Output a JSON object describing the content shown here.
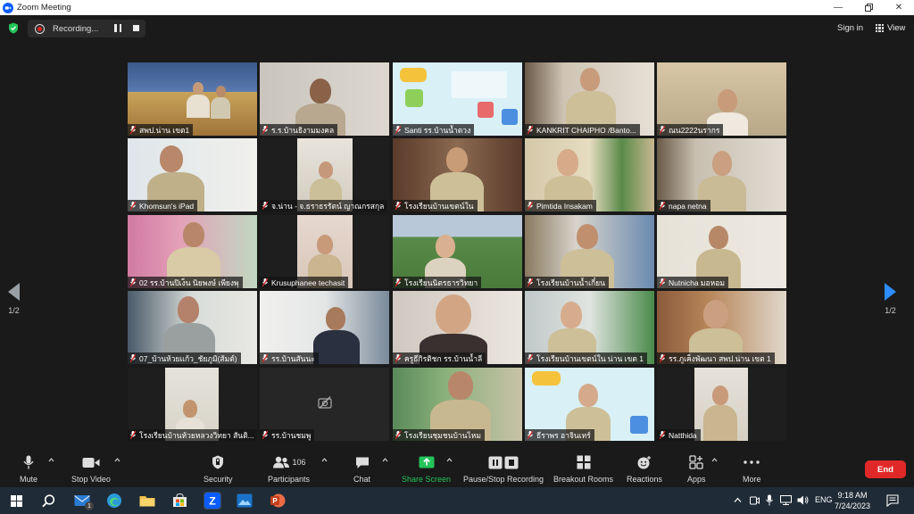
{
  "window": {
    "title": "Zoom Meeting"
  },
  "topbar": {
    "recording_label": "Recording...",
    "sign_in": "Sign in",
    "view": "View"
  },
  "gallery": {
    "page_indicator_left": "1/2",
    "page_indicator_right": "1/2",
    "tiles": [
      {
        "name": "สพป.น่าน เขต1"
      },
      {
        "name": "ร.ร.บ้านธิงามมงคล"
      },
      {
        "name": "Santi รร.บ้านน้ำตวง"
      },
      {
        "name": "KANKRIT CHAIPHO /Banto..."
      },
      {
        "name": "ณน2222นรากร"
      },
      {
        "name": "Khomsun's iPad"
      },
      {
        "name": "จ.น่าน - จ.ธราธรรัตน์ ญาณกรสกุล"
      },
      {
        "name": "โรงเรียนบ้านเขตน์ใน"
      },
      {
        "name": "Pimtida Insakam"
      },
      {
        "name": "napa netna"
      },
      {
        "name": "02 รร.บ้านปิเง็น นิยพงษ์ เพียงพุ"
      },
      {
        "name": "Krusuphanee techasit"
      },
      {
        "name": "โรงเรียนนิตรธารวิทยา"
      },
      {
        "name": "โรงเรียนบ้านน้ำเกี๋ยน"
      },
      {
        "name": "Nutnicha มอหอม"
      },
      {
        "name": "07_บ้านห้วยแก้ว_ชัยภูมิ(ส้มต์)"
      },
      {
        "name": "รร.บ้านสันนะ"
      },
      {
        "name": "ครูธีกิรติชก รร.บ้านน้ำลี"
      },
      {
        "name": "โรงเรียนบ้านเขตน์ใน น่าน เขต 1"
      },
      {
        "name": "รร.ภูเค็งพัฒนา สพป.น่าน เขต 1"
      },
      {
        "name": "โรงเรียนบ้านห้วยหลวงวิทยา สันติ..."
      },
      {
        "name": "รร.บ้านชมพู"
      },
      {
        "name": "โรงเรียนชุมชนบ้านไหม"
      },
      {
        "name": "ธีราพร อาจินเทร์"
      },
      {
        "name": "Natthida"
      }
    ]
  },
  "toolbar": {
    "mute": "Mute",
    "stop_video": "Stop Video",
    "security": "Security",
    "participants": "Participants",
    "participants_count": "106",
    "chat": "Chat",
    "share_screen": "Share Screen",
    "record": "Pause/Stop Recording",
    "breakout": "Breakout Rooms",
    "reactions": "Reactions",
    "apps": "Apps",
    "more": "More",
    "end": "End"
  },
  "taskbar": {
    "language": "ENG",
    "time": "9:18 AM",
    "date": "7/24/2023",
    "mail_badge": "1"
  },
  "colors": {
    "accent": "#2d8cff",
    "end": "#e02828",
    "share": "#23c45a"
  }
}
